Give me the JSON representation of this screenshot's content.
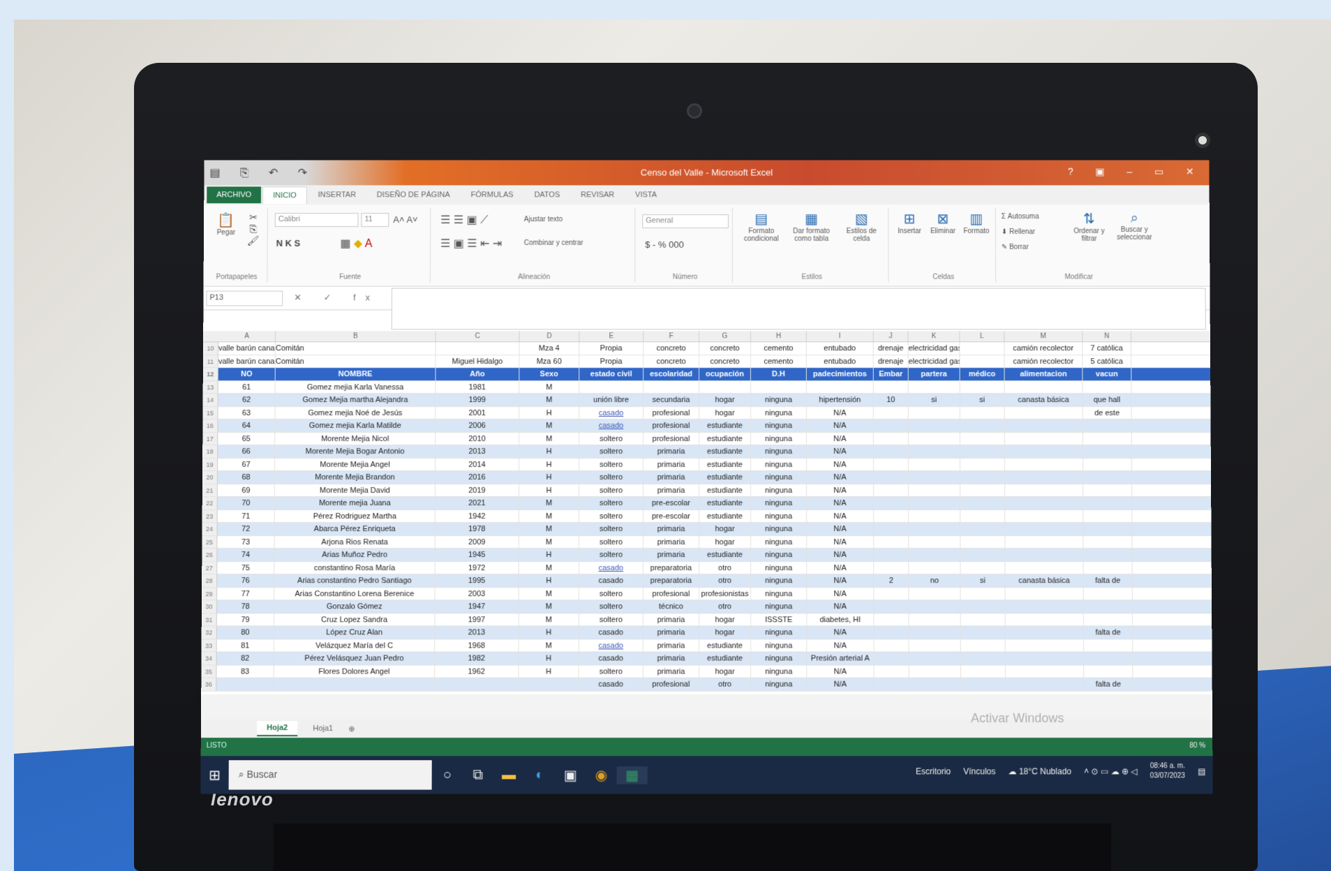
{
  "window": {
    "title": "Censo del Valle - Microsoft Excel",
    "controls": "? ▣ – ▭ ✕",
    "qat": "▤ ⎘ ↶ ↷"
  },
  "tabs": [
    "ARCHIVO",
    "INICIO",
    "INSERTAR",
    "DISEÑO DE PÁGINA",
    "FÓRMULAS",
    "DATOS",
    "REVISAR",
    "VISTA"
  ],
  "ribbon": {
    "paste": "Pegar",
    "clipboard": "Portapapeles",
    "font_name": "Calibri",
    "font_size": "11",
    "font_group": "Fuente",
    "font_buttons": "N K S",
    "wrap": "Ajustar texto",
    "merge": "Combinar y centrar",
    "align_group": "Alineación",
    "number_format": "General",
    "number_buttons": "$ - % 000",
    "number_group": "Número",
    "cond_format": "Formato condicional",
    "table_format": "Dar formato como tabla",
    "cell_styles": "Estilos de celda",
    "styles_group": "Estilos",
    "insert": "Insertar",
    "delete": "Eliminar",
    "format": "Formato",
    "cells_group": "Celdas",
    "autosum": "Autosuma",
    "fill": "Rellenar",
    "clear": "Borrar",
    "sort": "Ordenar y filtrar",
    "find": "Buscar y seleccionar",
    "edit_group": "Modificar"
  },
  "formula_bar": {
    "name_box": "P13",
    "fx": "✕ ✓ fx"
  },
  "columns": [
    "A",
    "B",
    "C",
    "D",
    "E",
    "F",
    "G",
    "H",
    "I",
    "J",
    "K",
    "L",
    "M",
    "N"
  ],
  "top_rows": [
    {
      "n": "10",
      "cells": [
        "valle barún canar",
        "Comitán",
        "",
        "Mza 4",
        "Propia",
        "concreto",
        "concreto",
        "cemento",
        "entubado",
        "drenaje",
        "electricidad gas",
        "",
        "camión recolector",
        "7 católica"
      ]
    },
    {
      "n": "11",
      "cells": [
        "valle barún canar",
        "Comitán",
        "Miguel Hidalgo",
        "Mza 60",
        "Propia",
        "concreto",
        "concreto",
        "cemento",
        "entubado",
        "drenaje",
        "electricidad gas",
        "",
        "camión recolector",
        "5 católica"
      ]
    }
  ],
  "header_row": {
    "n": "12",
    "cells": [
      "NO",
      "NOMBRE",
      "Año",
      "Sexo",
      "estado civil",
      "escolaridad",
      "ocupación",
      "D.H",
      "padecimientos",
      "Embar",
      "partera",
      "médico",
      "alimentacion",
      "vacun"
    ]
  },
  "rows": [
    {
      "n": "13",
      "cells": [
        "61",
        "Gomez mejia Karla Vanessa",
        "1981",
        "M",
        "",
        "",
        "",
        "",
        "",
        "",
        "",
        "",
        "",
        ""
      ]
    },
    {
      "n": "14",
      "cells": [
        "62",
        "Gomez Mejia martha Alejandra",
        "1999",
        "M",
        "unión libre",
        "secundaria",
        "hogar",
        "ninguna",
        "hipertensión",
        "10",
        "si",
        "si",
        "canasta básica",
        "que hall"
      ]
    },
    {
      "n": "15",
      "cells": [
        "63",
        "Gomez mejia Noé de Jesús",
        "2001",
        "H",
        "casado",
        "profesional",
        "hogar",
        "ninguna",
        "N/A",
        "",
        "",
        "",
        "",
        "de este"
      ]
    },
    {
      "n": "16",
      "cells": [
        "64",
        "Gomez mejia Karla Matilde",
        "2006",
        "M",
        "casado",
        "profesional",
        "estudiante",
        "ninguna",
        "N/A",
        "",
        "",
        "",
        "",
        ""
      ]
    },
    {
      "n": "17",
      "cells": [
        "65",
        "Morente Mejia Nicol",
        "2010",
        "M",
        "soltero",
        "profesional",
        "estudiante",
        "ninguna",
        "N/A",
        "",
        "",
        "",
        "",
        ""
      ]
    },
    {
      "n": "18",
      "cells": [
        "66",
        "Morente Mejia Bogar Antonio",
        "2013",
        "H",
        "soltero",
        "primaria",
        "estudiante",
        "ninguna",
        "N/A",
        "",
        "",
        "",
        "",
        ""
      ]
    },
    {
      "n": "19",
      "cells": [
        "67",
        "Morente Mejia Angel",
        "2014",
        "H",
        "soltero",
        "primaria",
        "estudiante",
        "ninguna",
        "N/A",
        "",
        "",
        "",
        "",
        ""
      ]
    },
    {
      "n": "20",
      "cells": [
        "68",
        "Morente Mejia Brandon",
        "2016",
        "H",
        "soltero",
        "primaria",
        "estudiante",
        "ninguna",
        "N/A",
        "",
        "",
        "",
        "",
        ""
      ]
    },
    {
      "n": "21",
      "cells": [
        "69",
        "Morente Mejia David",
        "2019",
        "H",
        "soltero",
        "primaria",
        "estudiante",
        "ninguna",
        "N/A",
        "",
        "",
        "",
        "",
        ""
      ]
    },
    {
      "n": "22",
      "cells": [
        "70",
        "Morente mejia Juana",
        "2021",
        "M",
        "soltero",
        "pre-escolar",
        "estudiante",
        "ninguna",
        "N/A",
        "",
        "",
        "",
        "",
        ""
      ]
    },
    {
      "n": "23",
      "cells": [
        "71",
        "Pérez Rodriguez Martha",
        "1942",
        "M",
        "soltero",
        "pre-escolar",
        "estudiante",
        "ninguna",
        "N/A",
        "",
        "",
        "",
        "",
        ""
      ]
    },
    {
      "n": "24",
      "cells": [
        "72",
        "Abarca Pérez Enriqueta",
        "1978",
        "M",
        "soltero",
        "primaria",
        "hogar",
        "ninguna",
        "N/A",
        "",
        "",
        "",
        "",
        ""
      ]
    },
    {
      "n": "25",
      "cells": [
        "73",
        "Arjona Rios Renata",
        "2009",
        "M",
        "soltero",
        "primaria",
        "hogar",
        "ninguna",
        "N/A",
        "",
        "",
        "",
        "",
        ""
      ]
    },
    {
      "n": "26",
      "cells": [
        "74",
        "Arias Muñoz Pedro",
        "1945",
        "H",
        "soltero",
        "primaria",
        "estudiante",
        "ninguna",
        "N/A",
        "",
        "",
        "",
        "",
        ""
      ]
    },
    {
      "n": "27",
      "cells": [
        "75",
        "constantino Rosa María",
        "1972",
        "M",
        "casado",
        "preparatoria",
        "otro",
        "ninguna",
        "N/A",
        "",
        "",
        "",
        "",
        ""
      ]
    },
    {
      "n": "28",
      "cells": [
        "76",
        "Arias constantino Pedro Santiago",
        "1995",
        "H",
        "casado",
        "preparatoria",
        "otro",
        "ninguna",
        "N/A",
        "2",
        "no",
        "si",
        "canasta básica",
        "falta de"
      ]
    },
    {
      "n": "29",
      "cells": [
        "77",
        "Arias Constantino Lorena Berenice",
        "2003",
        "M",
        "soltero",
        "profesional",
        "profesionistas",
        "ninguna",
        "N/A",
        "",
        "",
        "",
        "",
        ""
      ]
    },
    {
      "n": "30",
      "cells": [
        "78",
        "Gonzalo Gómez",
        "1947",
        "M",
        "soltero",
        "técnico",
        "otro",
        "ninguna",
        "N/A",
        "",
        "",
        "",
        "",
        ""
      ]
    },
    {
      "n": "31",
      "cells": [
        "79",
        "Cruz Lopez Sandra",
        "1997",
        "M",
        "soltero",
        "primaria",
        "hogar",
        "ISSSTE",
        "diabetes, HI",
        "",
        "",
        "",
        "",
        ""
      ]
    },
    {
      "n": "32",
      "cells": [
        "80",
        "López Cruz Alan",
        "2013",
        "H",
        "casado",
        "primaria",
        "hogar",
        "ninguna",
        "N/A",
        "",
        "",
        "",
        "",
        "falta de"
      ]
    },
    {
      "n": "33",
      "cells": [
        "81",
        "Velázquez María del C",
        "1968",
        "M",
        "casado",
        "primaria",
        "estudiante",
        "ninguna",
        "N/A",
        "",
        "",
        "",
        "",
        ""
      ]
    },
    {
      "n": "34",
      "cells": [
        "82",
        "Pérez Velásquez Juan Pedro",
        "1982",
        "H",
        "casado",
        "primaria",
        "estudiante",
        "ninguna",
        "Presión arterial A",
        "",
        "",
        "",
        "",
        ""
      ]
    },
    {
      "n": "35",
      "cells": [
        "83",
        "Flores Dolores Angel",
        "1962",
        "H",
        "soltero",
        "primaria",
        "hogar",
        "ninguna",
        "N/A",
        "",
        "",
        "",
        "",
        ""
      ]
    },
    {
      "n": "36",
      "cells": [
        "",
        "",
        "",
        "",
        "casado",
        "profesional",
        "otro",
        "ninguna",
        "N/A",
        "",
        "",
        "",
        "",
        "falta de"
      ]
    }
  ],
  "sheets": [
    "Hoja2",
    "Hoja1"
  ],
  "status": "LISTO",
  "zoom": "80 %",
  "watermark": "Activar Windows",
  "taskbar": {
    "search": "Buscar",
    "desk": "Escritorio",
    "links": "Vínculos",
    "weather": "18°C Nublado",
    "time": "08:46 a. m.",
    "date": "03/07/2023"
  },
  "brand": "lenovo"
}
